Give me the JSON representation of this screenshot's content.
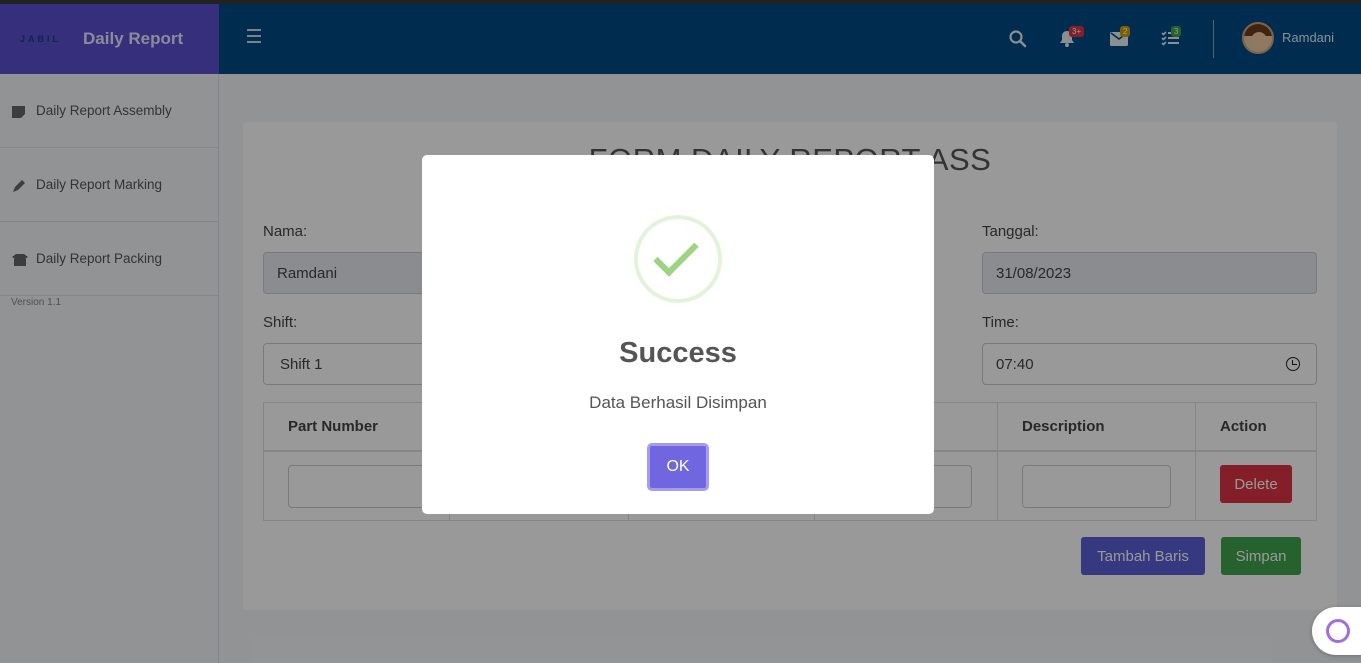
{
  "brand": {
    "logo": "JABIL",
    "title": "Daily Report"
  },
  "header": {
    "badges": {
      "notifications": "3+",
      "messages": "2",
      "tasks": "3"
    },
    "user_name": "Ramdani"
  },
  "sidebar": {
    "items": [
      {
        "label": "Daily Report Assembly",
        "icon": "sticky-note-icon"
      },
      {
        "label": "Daily Report Marking",
        "icon": "pen-icon"
      },
      {
        "label": "Daily Report Packing",
        "icon": "box-open-icon"
      }
    ],
    "version": "Version 1.1"
  },
  "form": {
    "title": "FORM DAILY REPORT ASS",
    "nama_label": "Nama:",
    "nama_value": "Ramdani",
    "tanggal_label": "Tanggal:",
    "tanggal_value": "31/08/2023",
    "shift_label": "Shift:",
    "shift_value": "Shift 1",
    "time_label": "Time:",
    "time_value": "07:40"
  },
  "table": {
    "headers": [
      "Part Number",
      "Description",
      "Action"
    ],
    "delete_label": "Delete"
  },
  "buttons": {
    "add_row": "Tambah Baris",
    "save": "Simpan"
  },
  "modal": {
    "title": "Success",
    "message": "Data Berhasil Disimpan",
    "ok_label": "OK"
  },
  "colors": {
    "brand_bg": "#5a4fcf",
    "header_bg": "#004a86",
    "ok_button": "#7066e0",
    "delete_button": "#dc3545",
    "add_row_button": "#5a5fd6",
    "save_button": "#3fa34d"
  }
}
